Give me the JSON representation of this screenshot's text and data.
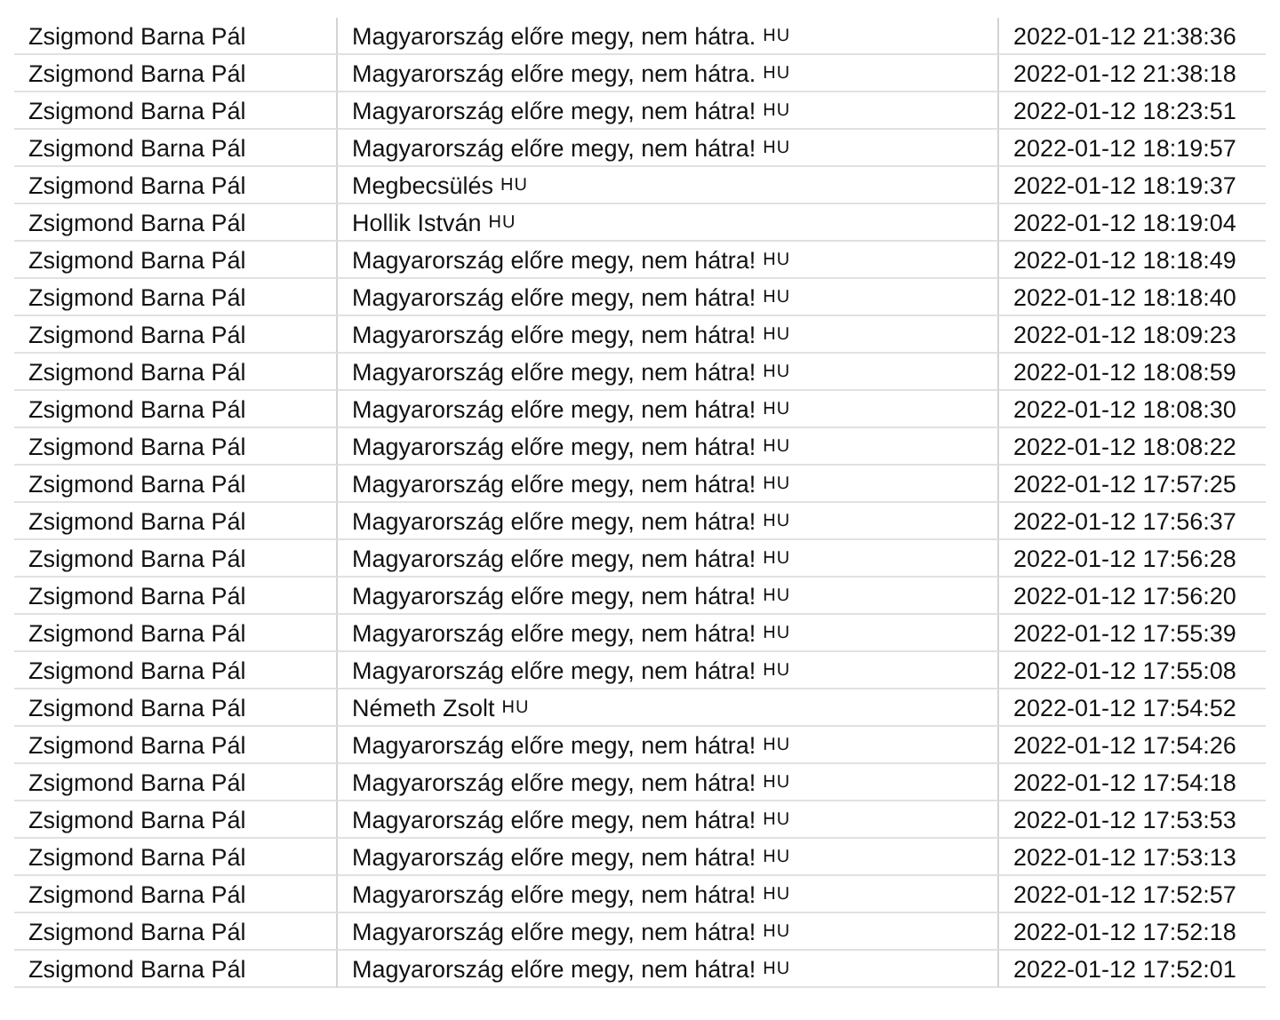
{
  "rows": [
    {
      "author": "Zsigmond Barna Pál",
      "title": "Magyarország előre megy, nem hátra.",
      "lang": "HU",
      "time": "2022-01-12 21:38:36"
    },
    {
      "author": "Zsigmond Barna Pál",
      "title": "Magyarország előre megy, nem hátra.",
      "lang": "HU",
      "time": "2022-01-12 21:38:18"
    },
    {
      "author": "Zsigmond Barna Pál",
      "title": "Magyarország előre megy, nem hátra!",
      "lang": "HU",
      "time": "2022-01-12 18:23:51"
    },
    {
      "author": "Zsigmond Barna Pál",
      "title": "Magyarország előre megy, nem hátra!",
      "lang": "HU",
      "time": "2022-01-12 18:19:57"
    },
    {
      "author": "Zsigmond Barna Pál",
      "title": "Megbecsülés",
      "lang": "HU",
      "time": "2022-01-12 18:19:37"
    },
    {
      "author": "Zsigmond Barna Pál",
      "title": "Hollik István",
      "lang": "HU",
      "time": "2022-01-12 18:19:04"
    },
    {
      "author": "Zsigmond Barna Pál",
      "title": "Magyarország előre megy, nem hátra!",
      "lang": "HU",
      "time": "2022-01-12 18:18:49"
    },
    {
      "author": "Zsigmond Barna Pál",
      "title": "Magyarország előre megy, nem hátra!",
      "lang": "HU",
      "time": "2022-01-12 18:18:40"
    },
    {
      "author": "Zsigmond Barna Pál",
      "title": "Magyarország előre megy, nem hátra!",
      "lang": "HU",
      "time": "2022-01-12 18:09:23"
    },
    {
      "author": "Zsigmond Barna Pál",
      "title": "Magyarország előre megy, nem hátra!",
      "lang": "HU",
      "time": "2022-01-12 18:08:59"
    },
    {
      "author": "Zsigmond Barna Pál",
      "title": "Magyarország előre megy, nem hátra!",
      "lang": "HU",
      "time": "2022-01-12 18:08:30"
    },
    {
      "author": "Zsigmond Barna Pál",
      "title": "Magyarország előre megy, nem hátra!",
      "lang": "HU",
      "time": "2022-01-12 18:08:22"
    },
    {
      "author": "Zsigmond Barna Pál",
      "title": "Magyarország előre megy, nem hátra!",
      "lang": "HU",
      "time": "2022-01-12 17:57:25"
    },
    {
      "author": "Zsigmond Barna Pál",
      "title": "Magyarország előre megy, nem hátra!",
      "lang": "HU",
      "time": "2022-01-12 17:56:37"
    },
    {
      "author": "Zsigmond Barna Pál",
      "title": "Magyarország előre megy, nem hátra!",
      "lang": "HU",
      "time": "2022-01-12 17:56:28"
    },
    {
      "author": "Zsigmond Barna Pál",
      "title": "Magyarország előre megy, nem hátra!",
      "lang": "HU",
      "time": "2022-01-12 17:56:20"
    },
    {
      "author": "Zsigmond Barna Pál",
      "title": "Magyarország előre megy, nem hátra!",
      "lang": "HU",
      "time": "2022-01-12 17:55:39"
    },
    {
      "author": "Zsigmond Barna Pál",
      "title": "Magyarország előre megy, nem hátra!",
      "lang": "HU",
      "time": "2022-01-12 17:55:08"
    },
    {
      "author": "Zsigmond Barna Pál",
      "title": "Németh Zsolt",
      "lang": "HU",
      "time": "2022-01-12 17:54:52"
    },
    {
      "author": "Zsigmond Barna Pál",
      "title": "Magyarország előre megy, nem hátra!",
      "lang": "HU",
      "time": "2022-01-12 17:54:26"
    },
    {
      "author": "Zsigmond Barna Pál",
      "title": "Magyarország előre megy, nem hátra!",
      "lang": "HU",
      "time": "2022-01-12 17:54:18"
    },
    {
      "author": "Zsigmond Barna Pál",
      "title": "Magyarország előre megy, nem hátra!",
      "lang": "HU",
      "time": "2022-01-12 17:53:53"
    },
    {
      "author": "Zsigmond Barna Pál",
      "title": "Magyarország előre megy, nem hátra!",
      "lang": "HU",
      "time": "2022-01-12 17:53:13"
    },
    {
      "author": "Zsigmond Barna Pál",
      "title": "Magyarország előre megy, nem hátra!",
      "lang": "HU",
      "time": "2022-01-12 17:52:57"
    },
    {
      "author": "Zsigmond Barna Pál",
      "title": "Magyarország előre megy, nem hátra!",
      "lang": "HU",
      "time": "2022-01-12 17:52:18"
    },
    {
      "author": "Zsigmond Barna Pál",
      "title": "Magyarország előre megy, nem hátra!",
      "lang": "HU",
      "time": "2022-01-12 17:52:01"
    }
  ]
}
